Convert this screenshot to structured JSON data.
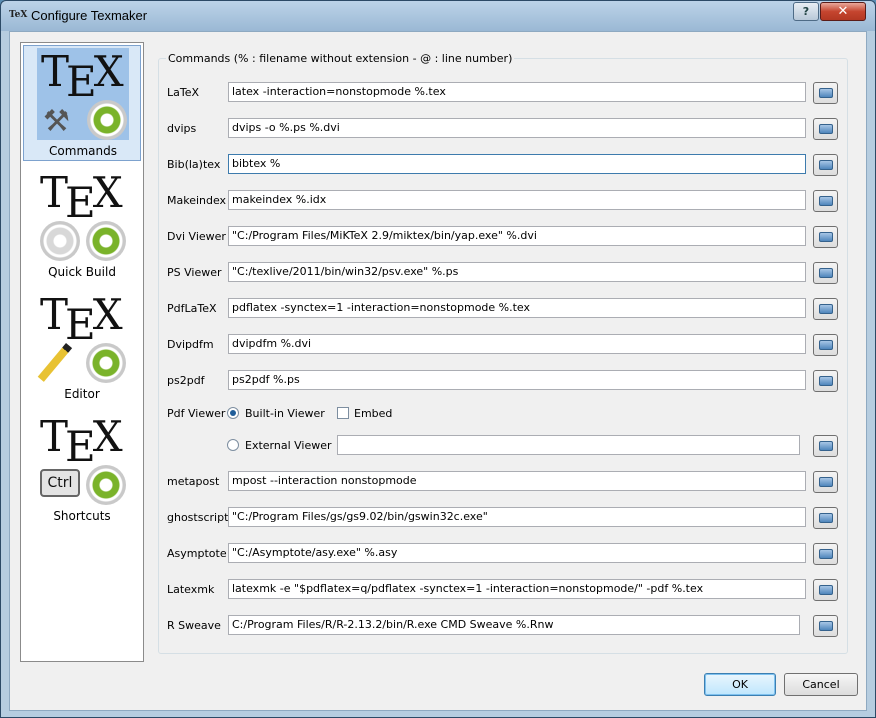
{
  "window": {
    "title": "Configure Texmaker",
    "app_icon_text": "TeX",
    "help": "?",
    "close": "✕"
  },
  "sidebar": {
    "items": [
      {
        "tile_text": "TEX",
        "label": "Commands"
      },
      {
        "tile_text": "TEX",
        "label": "Quick Build"
      },
      {
        "tile_text": "TEX",
        "label": "Editor"
      },
      {
        "tile_text": "TEX",
        "label": "Shortcuts",
        "key": "Ctrl"
      }
    ]
  },
  "group_title": "Commands (% : filename without extension - @ : line number)",
  "commands": [
    {
      "label": "LaTeX",
      "value": "latex -interaction=nonstopmode %.tex"
    },
    {
      "label": "dvips",
      "value": "dvips -o %.ps %.dvi"
    },
    {
      "label": "Bib(la)tex",
      "value": "bibtex %"
    },
    {
      "label": "Makeindex",
      "value": "makeindex %.idx"
    },
    {
      "label": "Dvi Viewer",
      "value": "\"C:/Program Files/MiKTeX 2.9/miktex/bin/yap.exe\" %.dvi"
    },
    {
      "label": "PS Viewer",
      "value": "\"C:/texlive/2011/bin/win32/psv.exe\" %.ps"
    },
    {
      "label": "PdfLaTeX",
      "value": "pdflatex -synctex=1 -interaction=nonstopmode %.tex"
    },
    {
      "label": "Dvipdfm",
      "value": "dvipdfm %.dvi"
    },
    {
      "label": "ps2pdf",
      "value": "ps2pdf %.ps"
    }
  ],
  "pdf_viewer": {
    "label": "Pdf Viewer",
    "builtin": "Built-in Viewer",
    "embed": "Embed",
    "external": "External Viewer",
    "external_value": ""
  },
  "commands2": [
    {
      "label": "metapost",
      "value": "mpost --interaction nonstopmode"
    },
    {
      "label": "ghostscript",
      "value": "\"C:/Program Files/gs/gs9.02/bin/gswin32c.exe\""
    },
    {
      "label": "Asymptote",
      "value": "\"C:/Asymptote/asy.exe\" %.asy"
    },
    {
      "label": "Latexmk",
      "value": "latexmk -e \"$pdflatex=q/pdflatex -synctex=1 -interaction=nonstopmode/\" -pdf %.tex"
    },
    {
      "label": "R Sweave",
      "value": "C:/Program Files/R/R-2.13.2/bin/R.exe CMD Sweave %.Rnw"
    }
  ],
  "buttons": {
    "ok": "OK",
    "cancel": "Cancel"
  }
}
